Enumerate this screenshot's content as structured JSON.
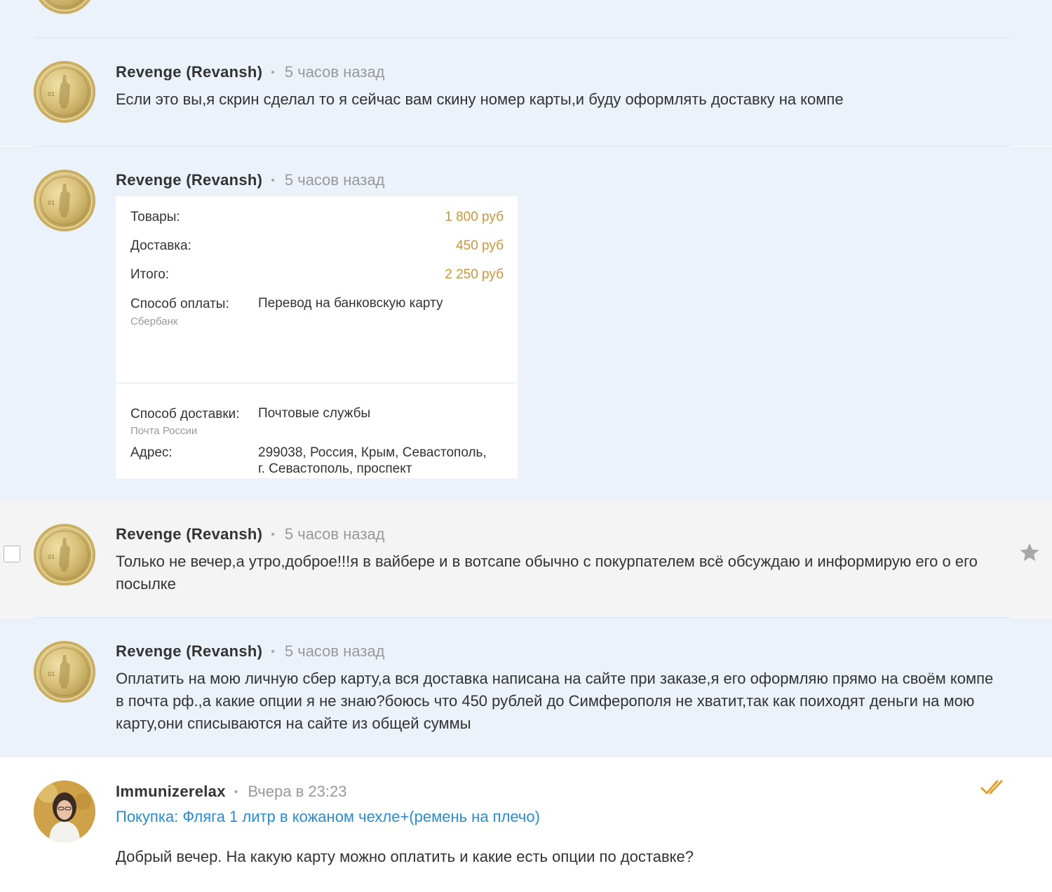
{
  "messages": [
    {
      "author": "Revenge (Revansh)",
      "time": "5 часов назад",
      "text": "Если это вы,я скрин сделал то я сейчас вам скину номер карты,и буду оформлять доставку на компе"
    },
    {
      "author": "Revenge (Revansh)",
      "time": "5 часов назад",
      "order": {
        "goods_label": "Товары:",
        "goods_value": "1 800 руб",
        "delivery_label": "Доставка:",
        "delivery_value": "450 руб",
        "total_label": "Итого:",
        "total_value": "2 250 руб",
        "payment_label": "Способ оплаты:",
        "payment_value": "Перевод на банковскую карту",
        "payment_sub": "Сбербанк",
        "shipping_label": "Способ доставки:",
        "shipping_value": "Почтовые службы",
        "shipping_sub": "Почта России",
        "address_label": "Адрес:",
        "address_line1": "299038, Россия, Крым, Севастополь,",
        "address_line2": "г. Севастополь, проспект"
      }
    },
    {
      "author": "Revenge (Revansh)",
      "time": "5 часов назад",
      "text": "Только не вечер,а утро,доброе!!!я в вайбере и в вотсапе обычно с покурпателем всё обсуждаю и информирую его о его посылке"
    },
    {
      "author": "Revenge (Revansh)",
      "time": "5 часов назад",
      "text": "Оплатить на мою личную сбер карту,а вся доставка написана на сайте при заказе,я его оформляю прямо на своём компе в почта рф.,а какие опции я не знаю?боюсь что 450 рублей до Симферополя не хватит,так как поиходят деньги на мою карту,они списываются на сайте из общей суммы"
    },
    {
      "author": "Immunizerelax",
      "time": "Вчера в 23:23",
      "purchase": "Покупка: Фляга 1 литр в кожаном чехле+(ремень на плечо)",
      "text": "Добрый вечер. На какую карту можно оплатить и какие есть опции по доставке?"
    }
  ],
  "icons": {
    "avatar_seller": "gold-coin-avatar",
    "avatar_buyer": "user-photo-avatar",
    "favorite": "star-icon",
    "read_status": "double-check-icon",
    "select": "checkbox"
  },
  "colors": {
    "seller_bg": "#ebf2fa",
    "highlight_bg": "#f4f4f4",
    "price": "#c8963c",
    "link": "#2a8ccf",
    "read_check": "#e0a030"
  }
}
